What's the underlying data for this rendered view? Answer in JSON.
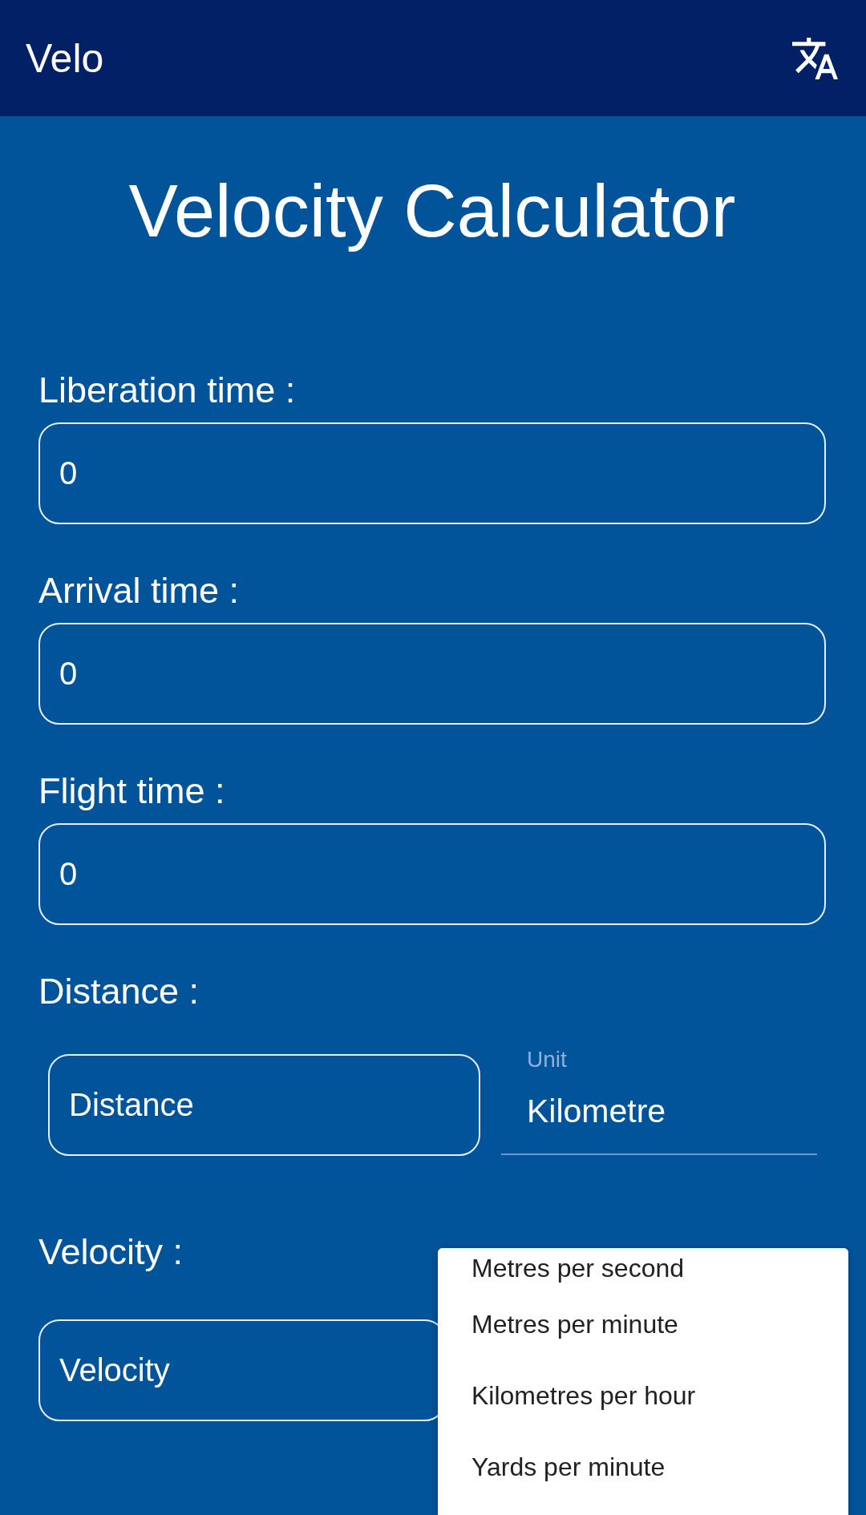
{
  "app_bar": {
    "title": "Velo"
  },
  "heading": "Velocity Calculator",
  "fields": [
    {
      "label": "Liberation time :",
      "value": "0"
    },
    {
      "label": "Arrival time :",
      "value": "0"
    },
    {
      "label": "Flight time :",
      "value": "0"
    }
  ],
  "distance": {
    "label": "Distance :",
    "placeholder": "Distance",
    "unit": {
      "label": "Unit",
      "value": "Kilometre"
    }
  },
  "velocity": {
    "label": "Velocity :",
    "placeholder": "Velocity"
  },
  "unit_menu": {
    "items": [
      {
        "label": "Metres per second",
        "selected": false
      },
      {
        "label": "Metres per minute",
        "selected": false
      },
      {
        "label": "Kilometres per hour",
        "selected": false
      },
      {
        "label": "Yards per minute",
        "selected": false
      }
    ]
  }
}
